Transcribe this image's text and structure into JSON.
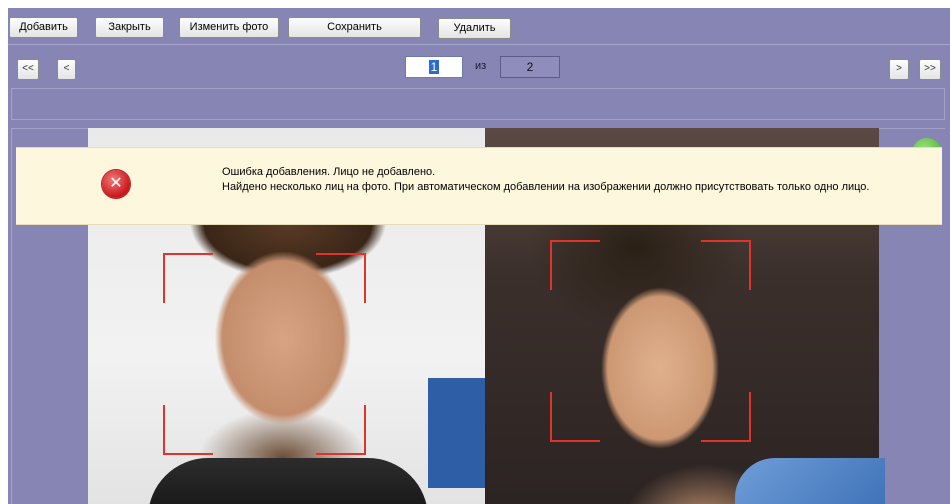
{
  "toolbar": {
    "add_label": "Добавить",
    "close_label": "Закрыть",
    "change_photo_label": "Изменить фото",
    "save_label": "Сохранить",
    "delete_label": "Удалить"
  },
  "pager": {
    "first_label": "<<",
    "prev_label": "<",
    "current_page": "1",
    "of_label": "из",
    "total_pages": "2",
    "next_label": ">",
    "last_label": ">>"
  },
  "error": {
    "line1": "Ошибка добавления. Лицо не добавлено.",
    "line2": "Найдено несколько лиц на фото. При автоматическом добавлении на изображении должно присутствовать только одно лицо.",
    "icon": "error-x-icon"
  },
  "colors": {
    "background": "#8785b4",
    "error_banner": "#fdf7dd",
    "face_frame": "#e0332b"
  }
}
